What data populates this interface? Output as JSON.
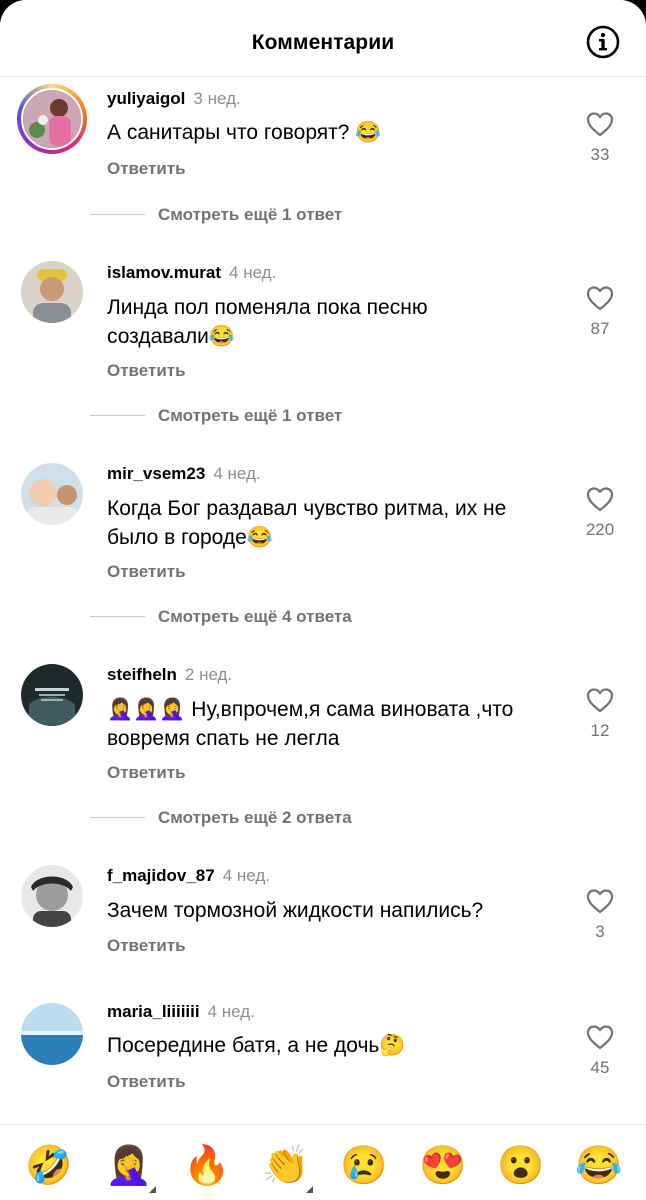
{
  "header": {
    "title": "Комментарии",
    "info_icon": "info-icon"
  },
  "comments": [
    {
      "username": "yuliyaigol",
      "time": "3 нед.",
      "text": "А санитары что говорят? 😂",
      "reply_label": "Ответить",
      "likes": "33",
      "more_replies": "Смотреть ещё 1 ответ",
      "has_story_ring": true
    },
    {
      "username": "islamov.murat",
      "time": "4 нед.",
      "text": "Линда пол поменяла пока песню создавали😂",
      "reply_label": "Ответить",
      "likes": "87",
      "more_replies": "Смотреть ещё 1 ответ"
    },
    {
      "username": "mir_vsem23",
      "time": "4 нед.",
      "text": "Когда Бог раздавал чувство ритма, их не было в городе😂",
      "reply_label": "Ответить",
      "likes": "220",
      "more_replies": "Смотреть ещё 4 ответа"
    },
    {
      "username": "steifheln",
      "time": "2 нед.",
      "text": "🤦‍♀️🤦‍♀️🤦‍♀️ Ну,впрочем,я сама виновата ,что вовремя спать не легла",
      "reply_label": "Ответить",
      "likes": "12",
      "more_replies": "Смотреть ещё 2 ответа"
    },
    {
      "username": "f_majidov_87",
      "time": "4 нед.",
      "text": "Зачем тормозной жидкости напились?",
      "reply_label": "Ответить",
      "likes": "3"
    },
    {
      "username": "maria_liiiiiii",
      "time": "4 нед.",
      "text": "Посередине батя, а не дочь🤔",
      "reply_label": "Ответить",
      "likes": "45"
    }
  ],
  "emoji_bar": [
    "🤣",
    "🤦‍♀️",
    "🔥",
    "👏",
    "😢",
    "😍",
    "😮",
    "😂"
  ]
}
